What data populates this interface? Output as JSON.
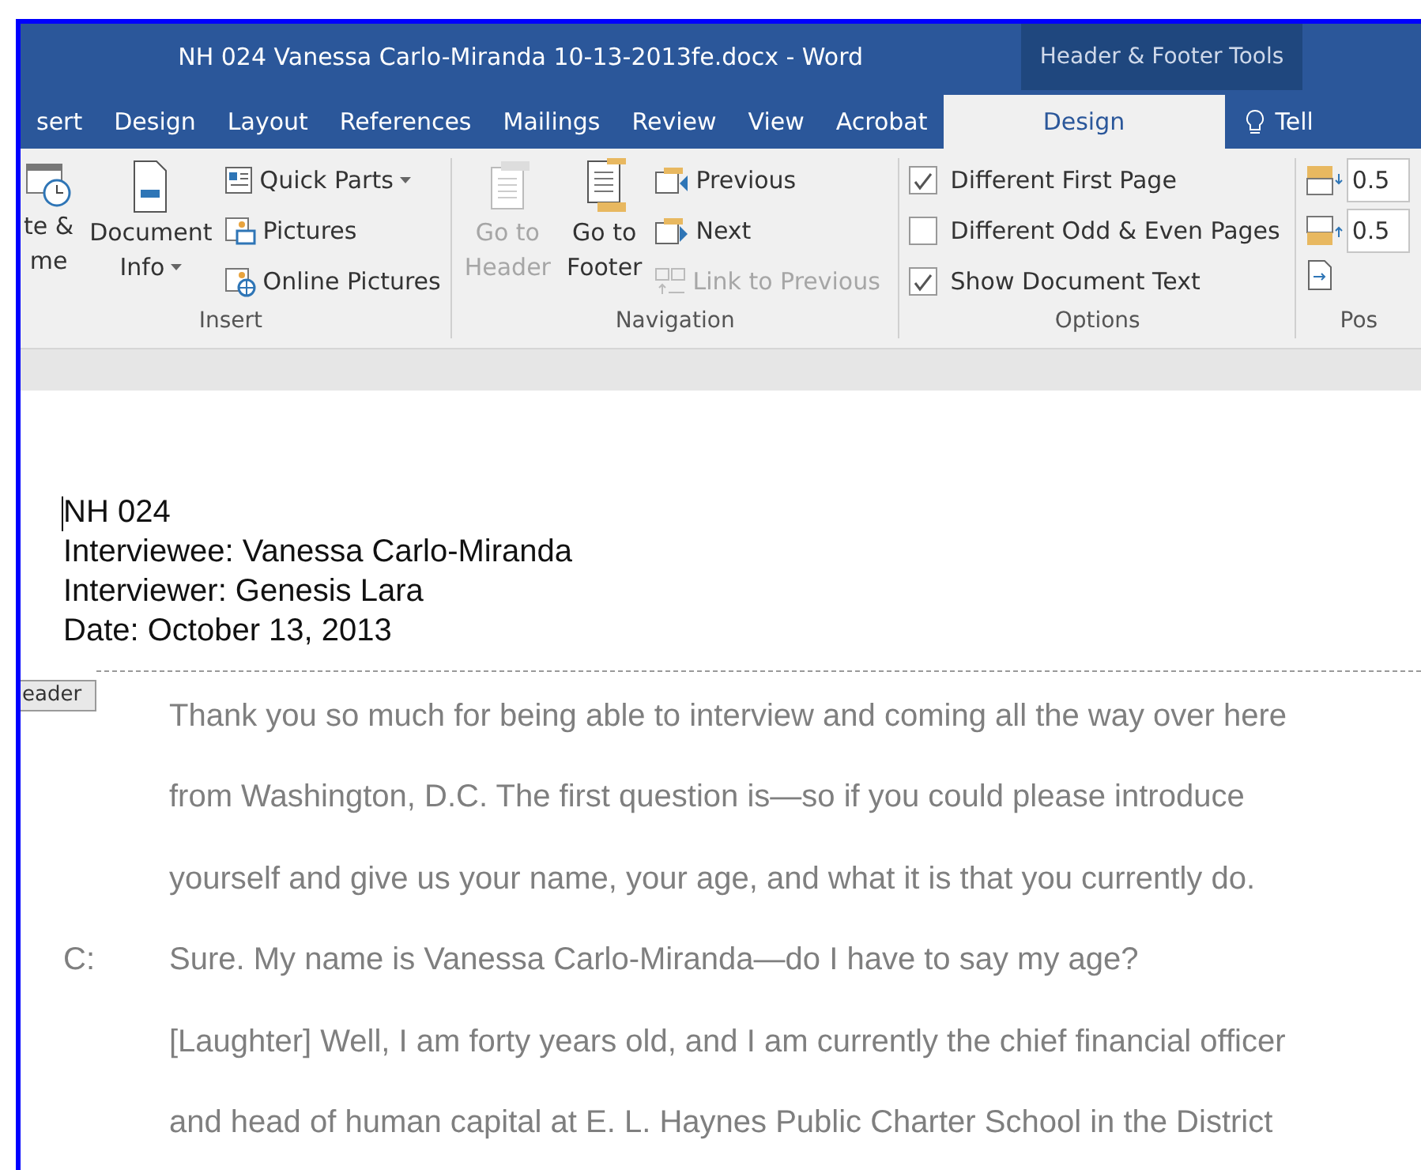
{
  "window": {
    "title": "NH 024 Vanessa Carlo-Miranda 10-13-2013fe.docx - Word",
    "context_title": "Header & Footer Tools"
  },
  "tabs": [
    {
      "label": "sert",
      "selected": false
    },
    {
      "label": "Design",
      "selected": false
    },
    {
      "label": "Layout",
      "selected": false
    },
    {
      "label": "References",
      "selected": false
    },
    {
      "label": "Mailings",
      "selected": false
    },
    {
      "label": "Review",
      "selected": false
    },
    {
      "label": "View",
      "selected": false
    },
    {
      "label": "Acrobat",
      "selected": false
    },
    {
      "label": "Design",
      "selected": true
    }
  ],
  "tell_me": "Tell",
  "ribbon": {
    "insert": {
      "label": "Insert",
      "large": [
        {
          "lines": [
            "te &",
            "me"
          ],
          "dropdown": false
        },
        {
          "lines": [
            "Document",
            "Info"
          ],
          "dropdown": true
        }
      ],
      "small": [
        {
          "label": "Quick Parts",
          "dropdown": true
        },
        {
          "label": "Pictures",
          "dropdown": false
        },
        {
          "label": "Online Pictures",
          "dropdown": false
        }
      ]
    },
    "navigation": {
      "label": "Navigation",
      "large": [
        {
          "lines": [
            "Go to",
            "Header"
          ],
          "disabled": true
        },
        {
          "lines": [
            "Go to",
            "Footer"
          ],
          "disabled": false
        }
      ],
      "small": [
        {
          "label": "Previous",
          "disabled": false
        },
        {
          "label": "Next",
          "disabled": false
        },
        {
          "label": "Link to Previous",
          "disabled": true
        }
      ]
    },
    "options": {
      "label": "Options",
      "checks": [
        {
          "label": "Different First Page",
          "checked": true
        },
        {
          "label": "Different Odd & Even Pages",
          "checked": false
        },
        {
          "label": "Show Document Text",
          "checked": true
        }
      ]
    },
    "position": {
      "label": "Pos",
      "fields": [
        {
          "value": "0.5"
        },
        {
          "value": "0.5"
        }
      ]
    }
  },
  "document": {
    "header_lines": [
      "NH 024",
      "Interviewee: Vanessa Carlo-Miranda",
      "Interviewer: Genesis Lara",
      "Date: October 13, 2013"
    ],
    "header_tag": "eader",
    "body_lines": [
      {
        "text": "Thank you so much for being able to interview and coming all the way over here"
      },
      {
        "text": "from Washington, D.C. The first question is—so if you could please introduce"
      },
      {
        "text": "yourself and give us your name, your age, and what it is that you currently do."
      },
      {
        "speaker": "C:",
        "text": "Sure. My name is Vanessa Carlo-Miranda—do I have to say my age?"
      },
      {
        "text": "[Laughter] Well, I am forty years old, and I am currently the chief financial officer"
      },
      {
        "text": "and head of human capital at E. L. Haynes Public Charter School in the District"
      }
    ]
  }
}
